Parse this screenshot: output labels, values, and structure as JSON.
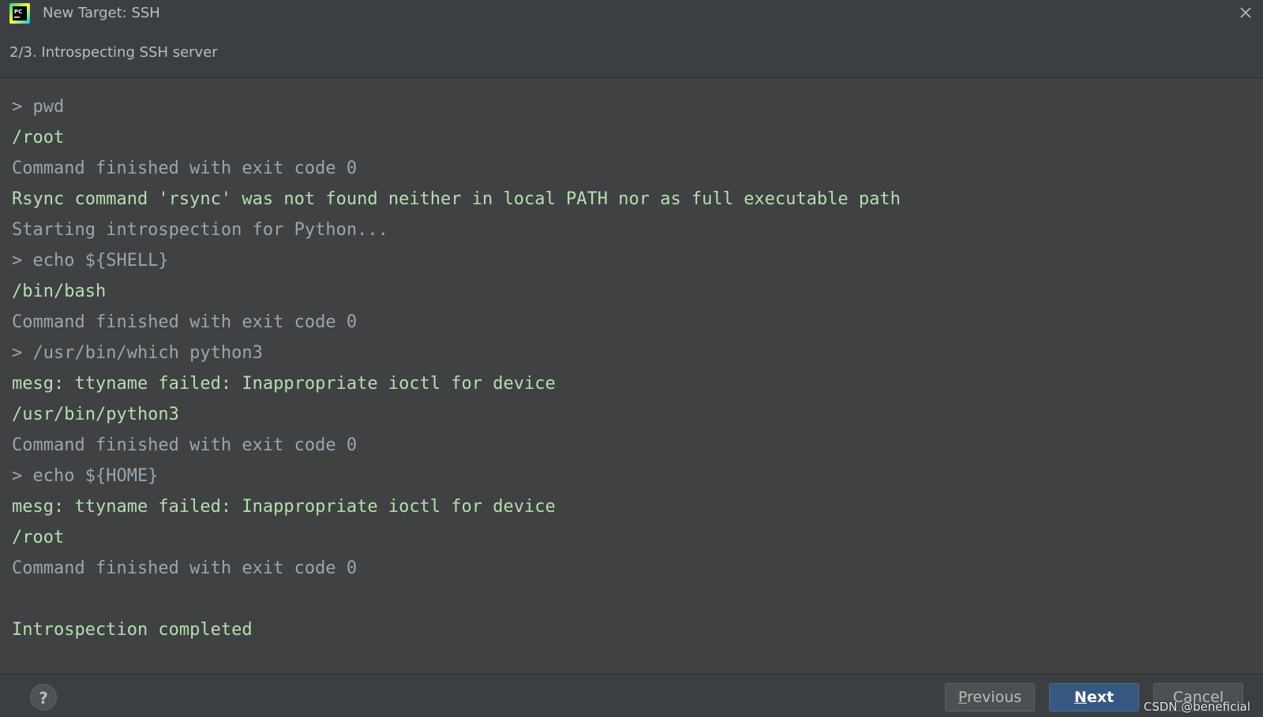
{
  "window": {
    "title": "New Target: SSH",
    "app_icon": "pycharm-logo-icon",
    "close_icon": "close-icon"
  },
  "wizard": {
    "step_title": "2/3. Introspecting SSH server"
  },
  "console": {
    "lines": [
      {
        "text": "> pwd",
        "kind": "cmd"
      },
      {
        "text": "/root",
        "kind": "out"
      },
      {
        "text": "Command finished with exit code 0",
        "kind": "sys"
      },
      {
        "text": "Rsync command 'rsync' was not found neither in local PATH nor as full executable path",
        "kind": "out"
      },
      {
        "text": "Starting introspection for Python...",
        "kind": "sys"
      },
      {
        "text": "> echo ${SHELL}",
        "kind": "cmd"
      },
      {
        "text": "/bin/bash",
        "kind": "out"
      },
      {
        "text": "Command finished with exit code 0",
        "kind": "sys"
      },
      {
        "text": "> /usr/bin/which python3",
        "kind": "cmd"
      },
      {
        "text": "mesg: ttyname failed: Inappropriate ioctl for device",
        "kind": "out"
      },
      {
        "text": "/usr/bin/python3",
        "kind": "out"
      },
      {
        "text": "Command finished with exit code 0",
        "kind": "sys"
      },
      {
        "text": "> echo ${HOME}",
        "kind": "cmd"
      },
      {
        "text": "mesg: ttyname failed: Inappropriate ioctl for device",
        "kind": "out"
      },
      {
        "text": "/root",
        "kind": "out"
      },
      {
        "text": "Command finished with exit code 0",
        "kind": "sys"
      },
      {
        "text": "",
        "kind": "blank"
      },
      {
        "text": "Introspection completed",
        "kind": "out"
      }
    ]
  },
  "footer": {
    "help_label": "?",
    "previous_mnemonic": "P",
    "previous_rest": "revious",
    "next_mnemonic": "N",
    "next_rest": "ext",
    "cancel_label": "Cancel"
  },
  "watermark": "CSDN @beneficial",
  "colors": {
    "background": "#3c3f41",
    "console_bg": "#404142",
    "output_green": "#b5dfb1",
    "command_gray": "#a9b7c6",
    "primary_button": "#365880"
  }
}
